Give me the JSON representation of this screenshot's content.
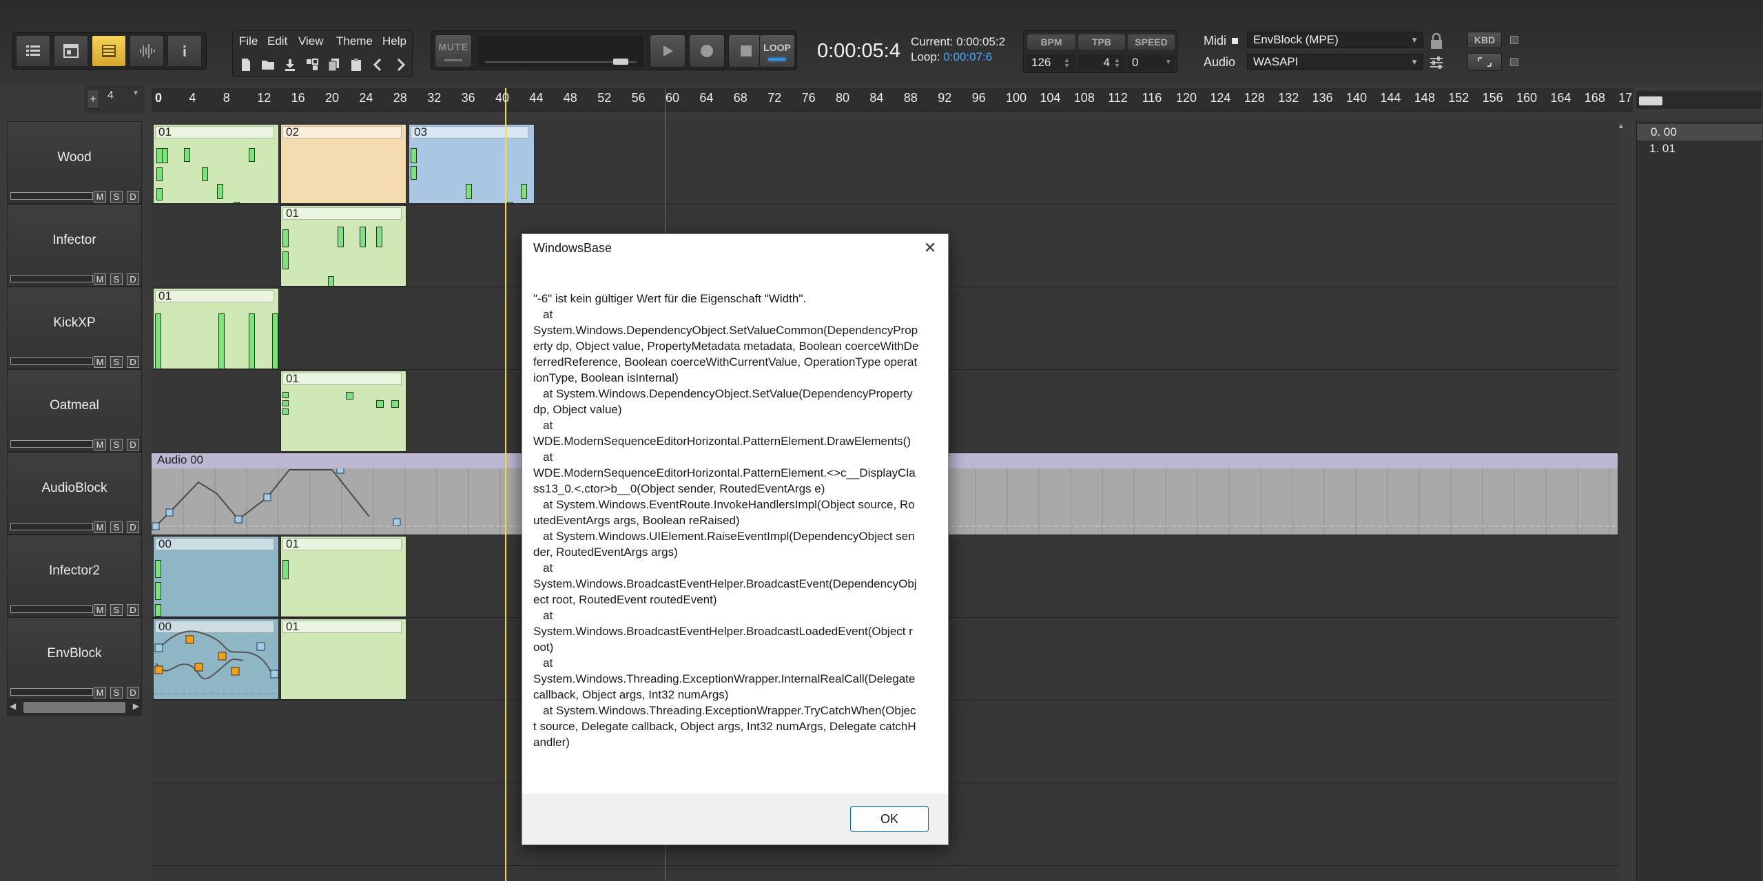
{
  "menu": {
    "file": "File",
    "edit": "Edit",
    "view": "View",
    "theme": "Theme",
    "help": "Help"
  },
  "transport": {
    "mute_label": "MUTE",
    "loop_label": "LOOP",
    "time": "0:00:05:4",
    "current_label": "Current: 0:00:05:2",
    "loop_prefix": "Loop: ",
    "loop_value": "0:00:07:6",
    "volume_level": 0.8
  },
  "tempo": {
    "bpm_label": "BPM",
    "tpb_label": "TPB",
    "speed_label": "SPEED",
    "bpm_value": "126",
    "tpb_value": "4",
    "speed_value": "0"
  },
  "io": {
    "midi_label": "Midi",
    "audio_label": "Audio",
    "midi_device": "EnvBlock (MPE)",
    "audio_device": "WASAPI",
    "kbd_label": "KBD"
  },
  "ruler": {
    "zoom_value": "4",
    "ticks": [
      "0",
      "4",
      "8",
      "12",
      "16",
      "20",
      "24",
      "28",
      "32",
      "36",
      "40",
      "44",
      "48",
      "52",
      "56",
      "60",
      "64",
      "68",
      "72",
      "76",
      "80",
      "84",
      "88",
      "92",
      "96",
      "100",
      "104",
      "108",
      "112",
      "116",
      "120",
      "124",
      "128",
      "132",
      "136",
      "140",
      "144",
      "148",
      "152",
      "156",
      "160",
      "164",
      "168",
      "17"
    ]
  },
  "tracks": [
    {
      "name": "Wood"
    },
    {
      "name": "Infector"
    },
    {
      "name": "KickXP"
    },
    {
      "name": "Oatmeal"
    },
    {
      "name": "AudioBlock"
    },
    {
      "name": "Infector2"
    },
    {
      "name": "EnvBlock"
    }
  ],
  "track_buttons": {
    "mute": "M",
    "solo": "S",
    "delete": "D"
  },
  "patterns": {
    "wood_01": "01",
    "wood_02": "02",
    "wood_03": "03",
    "infector_01": "01",
    "kick_01": "01",
    "oatmeal_01": "01",
    "audio_00": "Audio 00",
    "infector2_00": "00",
    "infector2_01": "01",
    "env_00": "00",
    "env_01": "01"
  },
  "pattern_list": [
    "0. 00",
    "1. 01"
  ],
  "dialog": {
    "title": "WindowsBase",
    "message": "\"-6\" ist kein gültiger Wert für die Eigenschaft \"Width\".\n   at\nSystem.Windows.DependencyObject.SetValueCommon(DependencyProperty dp, Object value, PropertyMetadata metadata, Boolean coerceWithDeferredReference, Boolean coerceWithCurrentValue, OperationType operationType, Boolean isInternal)\n   at System.Windows.DependencyObject.SetValue(DependencyProperty dp, Object value)\n   at\nWDE.ModernSequenceEditorHorizontal.PatternElement.DrawElements()\n   at\nWDE.ModernSequenceEditorHorizontal.PatternElement.<>c__DisplayClass13_0.<.ctor>b__0(Object sender, RoutedEventArgs e)\n   at System.Windows.EventRoute.InvokeHandlersImpl(Object source, RoutedEventArgs args, Boolean reRaised)\n   at System.Windows.UIElement.RaiseEventImpl(DependencyObject sender, RoutedEventArgs args)\n   at\nSystem.Windows.BroadcastEventHelper.BroadcastEvent(DependencyObject root, RoutedEvent routedEvent)\n   at\nSystem.Windows.BroadcastEventHelper.BroadcastLoadedEvent(Object root)\n   at\nSystem.Windows.Threading.ExceptionWrapper.InternalRealCall(Delegate callback, Object args, Int32 numArgs)\n   at System.Windows.Threading.ExceptionWrapper.TryCatchWhen(Object source, Delegate callback, Object args, Int32 numArgs, Delegate catchHandler)",
    "ok_label": "OK",
    "close_glyph": "✕"
  },
  "colors": {
    "active_view": "#f4d25a",
    "loop_accent": "#3a8fdc",
    "playhead": "#f0e040",
    "loop_marker": "#e23a3a",
    "waveform": "#d91616"
  },
  "icons": [
    "list-icon",
    "window-icon",
    "pattern-view-icon",
    "waveform-icon",
    "info-icon",
    "new-file-icon",
    "open-folder-icon",
    "save-icon",
    "export-icon",
    "copy-icon",
    "paste-icon",
    "back-icon",
    "forward-icon",
    "play-icon",
    "record-icon",
    "stop-icon",
    "lock-icon",
    "mixer-icon",
    "fit-icon"
  ]
}
